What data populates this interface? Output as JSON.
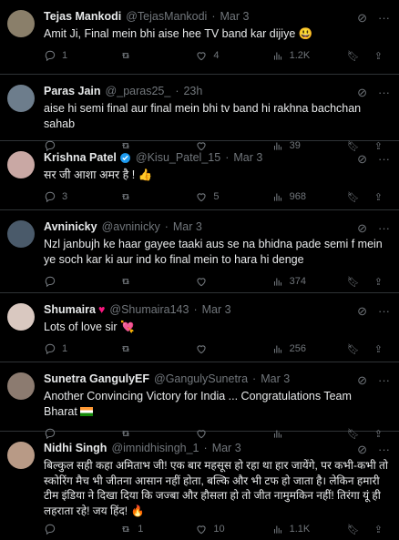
{
  "tweets": [
    {
      "name": "Tejas Mankodi",
      "handle": "@TejasMankodi",
      "time": "Mar 3",
      "text": "Amit Ji, Final mein bhi aise hee TV band kar dijiye 😃",
      "replies": "1",
      "retweets": "",
      "likes": "4",
      "views": "1.2K",
      "avatar_color": "#8a7f6a"
    },
    {
      "name": "Paras Jain",
      "handle": "@_paras25_",
      "time": "23h",
      "text": "aise hi semi final aur final mein bhi tv band hi rakhna bachchan sahab",
      "replies": "",
      "retweets": "",
      "likes": "",
      "views": "39",
      "avatar_color": "#6d7d8c"
    },
    {
      "name": "Krishna Patel",
      "handle": "@Kisu_Patel_15",
      "time": "Mar 3",
      "text": "सर जी आशा अमर है ! 👍",
      "replies": "3",
      "retweets": "",
      "likes": "5",
      "views": "968",
      "avatar_color": "#c9a8a4"
    },
    {
      "name": "Avninicky",
      "handle": "@avninicky",
      "time": "Mar 3",
      "text": "Nzl janbujh ke haar gayee taaki aus se na bhidna pade semi f mein ye soch kar ki aur ind ko final mein to hara hi denge",
      "replies": "",
      "retweets": "",
      "likes": "",
      "views": "374",
      "avatar_color": "#4a5a6a"
    },
    {
      "name": "Shumaira",
      "handle": "@Shumaira143",
      "time": "Mar 3",
      "text": "Lots of love sir 💘",
      "replies": "1",
      "retweets": "",
      "likes": "",
      "views": "256",
      "avatar_color": "#d9c8c0"
    },
    {
      "name": "Sunetra GangulyEF",
      "handle": "@GangulySunetra",
      "time": "Mar 3",
      "text": "Another  Convincing Victory for India ... Congratulations Team Bharat",
      "replies": "",
      "retweets": "",
      "likes": "",
      "views": "",
      "avatar_color": "#8c7b70"
    },
    {
      "name": "Nidhi Singh",
      "handle": "@imnidhisingh_1",
      "time": "Mar 3",
      "text": "बिल्कुल सही कहा अमिताभ जी! एक बार महसूस हो रहा था हार जायेंगे, पर कभी-कभी तो स्कोरिंग मैच भी जीतना आसान नहीं होता, बल्कि और भी टफ हो जाता है। लेकिन हमारी टीम इंडिया ने दिखा दिया कि जज्बा और हौसला हो तो जीत नामुमकिन नहीं! तिरंगा यूं ही लहराता रहे! जय हिंद! 🔥",
      "replies": "",
      "retweets": "1",
      "likes": "10",
      "views": "1.1K",
      "avatar_color": "#b89a86"
    }
  ]
}
